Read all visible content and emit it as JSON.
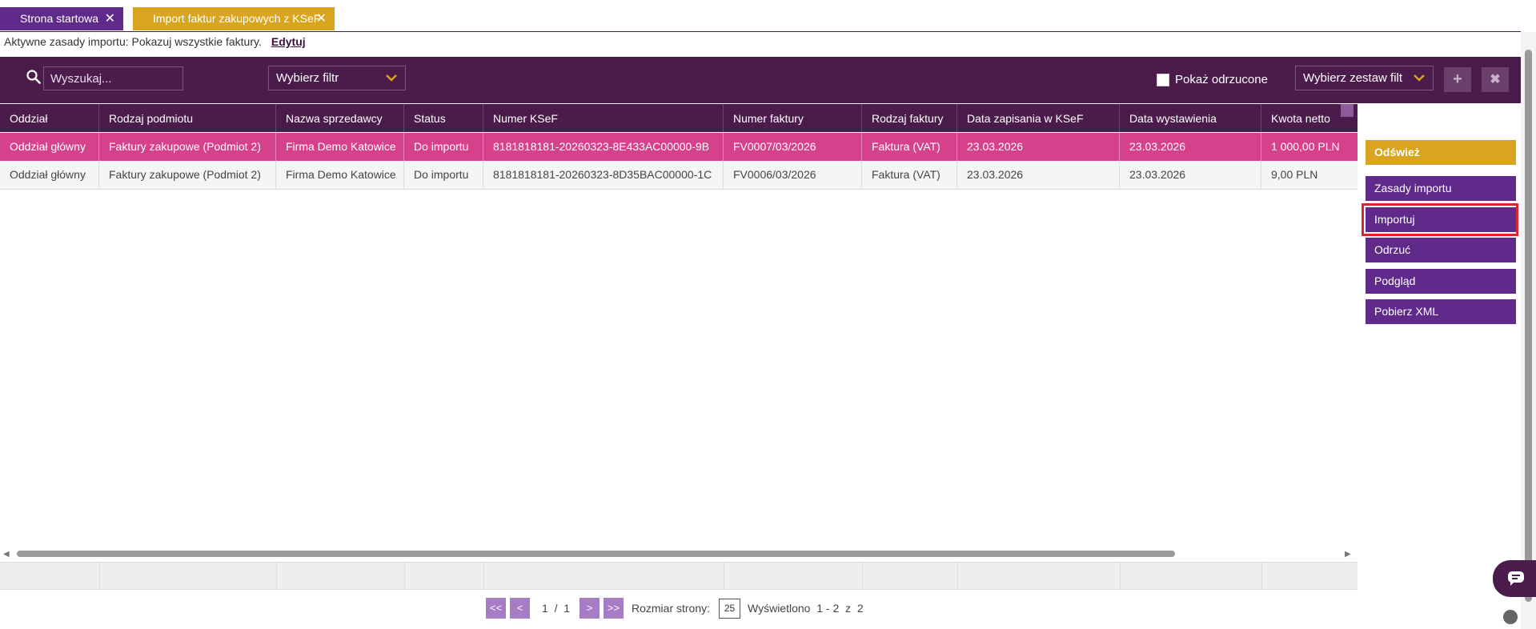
{
  "tabs": [
    {
      "label": "Strona startowa",
      "close": "✕"
    },
    {
      "label": "Import faktur zakupowych z KSeF",
      "close": "✕"
    }
  ],
  "info": {
    "text": "Aktywne zasady importu: Pokazuj wszystkie faktury.",
    "edit": "Edytuj"
  },
  "toolbar": {
    "search_placeholder": "Wyszukaj...",
    "filter_select": "Wybierz filtr",
    "show_rejected": "Pokaż odrzucone",
    "filter_set_select": "Wybierz zestaw filt",
    "add": "+",
    "delete": "✖"
  },
  "table": {
    "columns": [
      "Oddział",
      "Rodzaj podmiotu",
      "Nazwa sprzedawcy",
      "Status",
      "Numer KSeF",
      "Numer faktury",
      "Rodzaj faktury",
      "Data zapisania w KSeF",
      "Data wystawienia",
      "Kwota netto"
    ],
    "more": "...",
    "rows": [
      [
        "Oddział główny",
        "Faktury zakupowe (Podmiot 2)",
        "Firma Demo Katowice",
        "Do importu",
        "8181818181-20260323-8E433AC00000-9B",
        "FV0007/03/2026",
        "Faktura (VAT)",
        "23.03.2026",
        "23.03.2026",
        "1 000,00 PLN"
      ],
      [
        "Oddział główny",
        "Faktury zakupowe (Podmiot 2)",
        "Firma Demo Katowice",
        "Do importu",
        "8181818181-20260323-8D35BAC00000-1C",
        "FV0006/03/2026",
        "Faktura (VAT)",
        "23.03.2026",
        "23.03.2026",
        "9,00 PLN"
      ]
    ]
  },
  "pager": {
    "first": "<<",
    "prev": "<",
    "current": "1",
    "sep": "/",
    "total": "1",
    "next": ">",
    "last": ">>",
    "size_label": "Rozmiar strony:",
    "size": "25",
    "shown_label": "Wyświetlono",
    "shown_range": "1 - 2",
    "of": "z",
    "shown_total": "2"
  },
  "side": {
    "refresh": "Odśwież",
    "rules": "Zasady importu",
    "import": "Importuj",
    "reject": "Odrzuć",
    "preview": "Podgląd",
    "download_xml": "Pobierz XML"
  },
  "colors": {
    "primary": "#4b1c4b",
    "accent": "#5f2a8a",
    "gold": "#d9a41e",
    "selected": "#d6418b",
    "highlight": "#e0242f"
  }
}
